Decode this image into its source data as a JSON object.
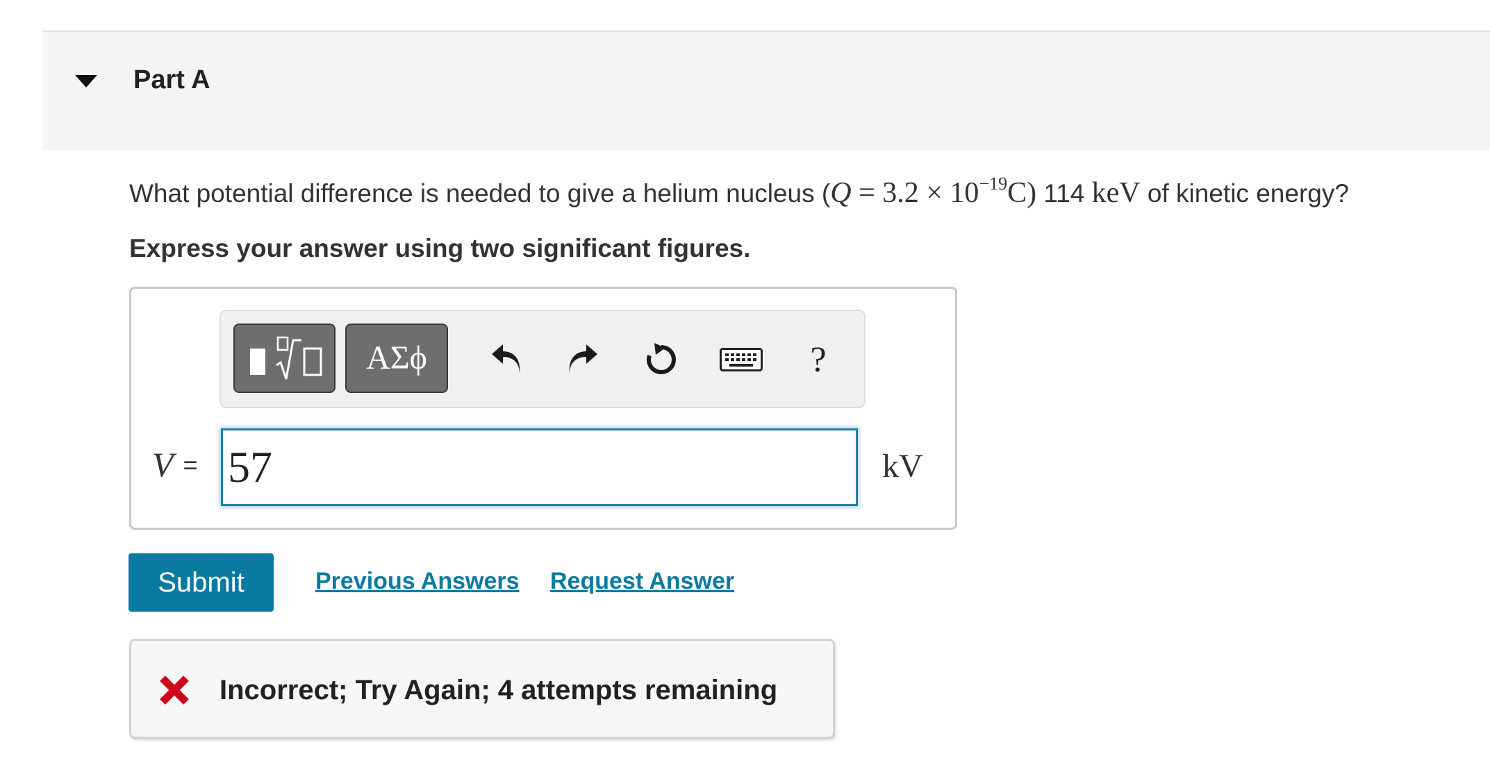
{
  "part": {
    "title": "Part A",
    "toggle_icon": "caret-down-icon"
  },
  "question": {
    "text_before": "What potential difference is needed to give a helium nucleus (",
    "q_var": "Q",
    "q_value": " = 3.2 × 10",
    "q_exp": "−19",
    "q_unit": "C)",
    "energy_value": " 114 ",
    "energy_unit": "keV",
    "text_after": " of kinetic energy?"
  },
  "instruction": "Express your answer using two significant figures.",
  "toolbar": {
    "templates_icon": "templates-sqrt-icon",
    "symbols_label": "ΑΣϕ",
    "undo_icon": "undo-icon",
    "redo_icon": "redo-icon",
    "reset_icon": "reset-icon",
    "keyboard_icon": "keyboard-icon",
    "help_label": "?"
  },
  "answer": {
    "variable": "V",
    "equals": "=",
    "value": "57",
    "unit": "kV"
  },
  "actions": {
    "submit_label": "Submit",
    "previous_answers_label": "Previous Answers",
    "request_answer_label": "Request Answer"
  },
  "feedback": {
    "icon": "x-icon",
    "message": "Incorrect; Try Again; 4 attempts remaining",
    "icon_color": "#d0021b"
  },
  "colors": {
    "accent": "#0a7aa0",
    "header_bg": "#f5f5f5"
  }
}
